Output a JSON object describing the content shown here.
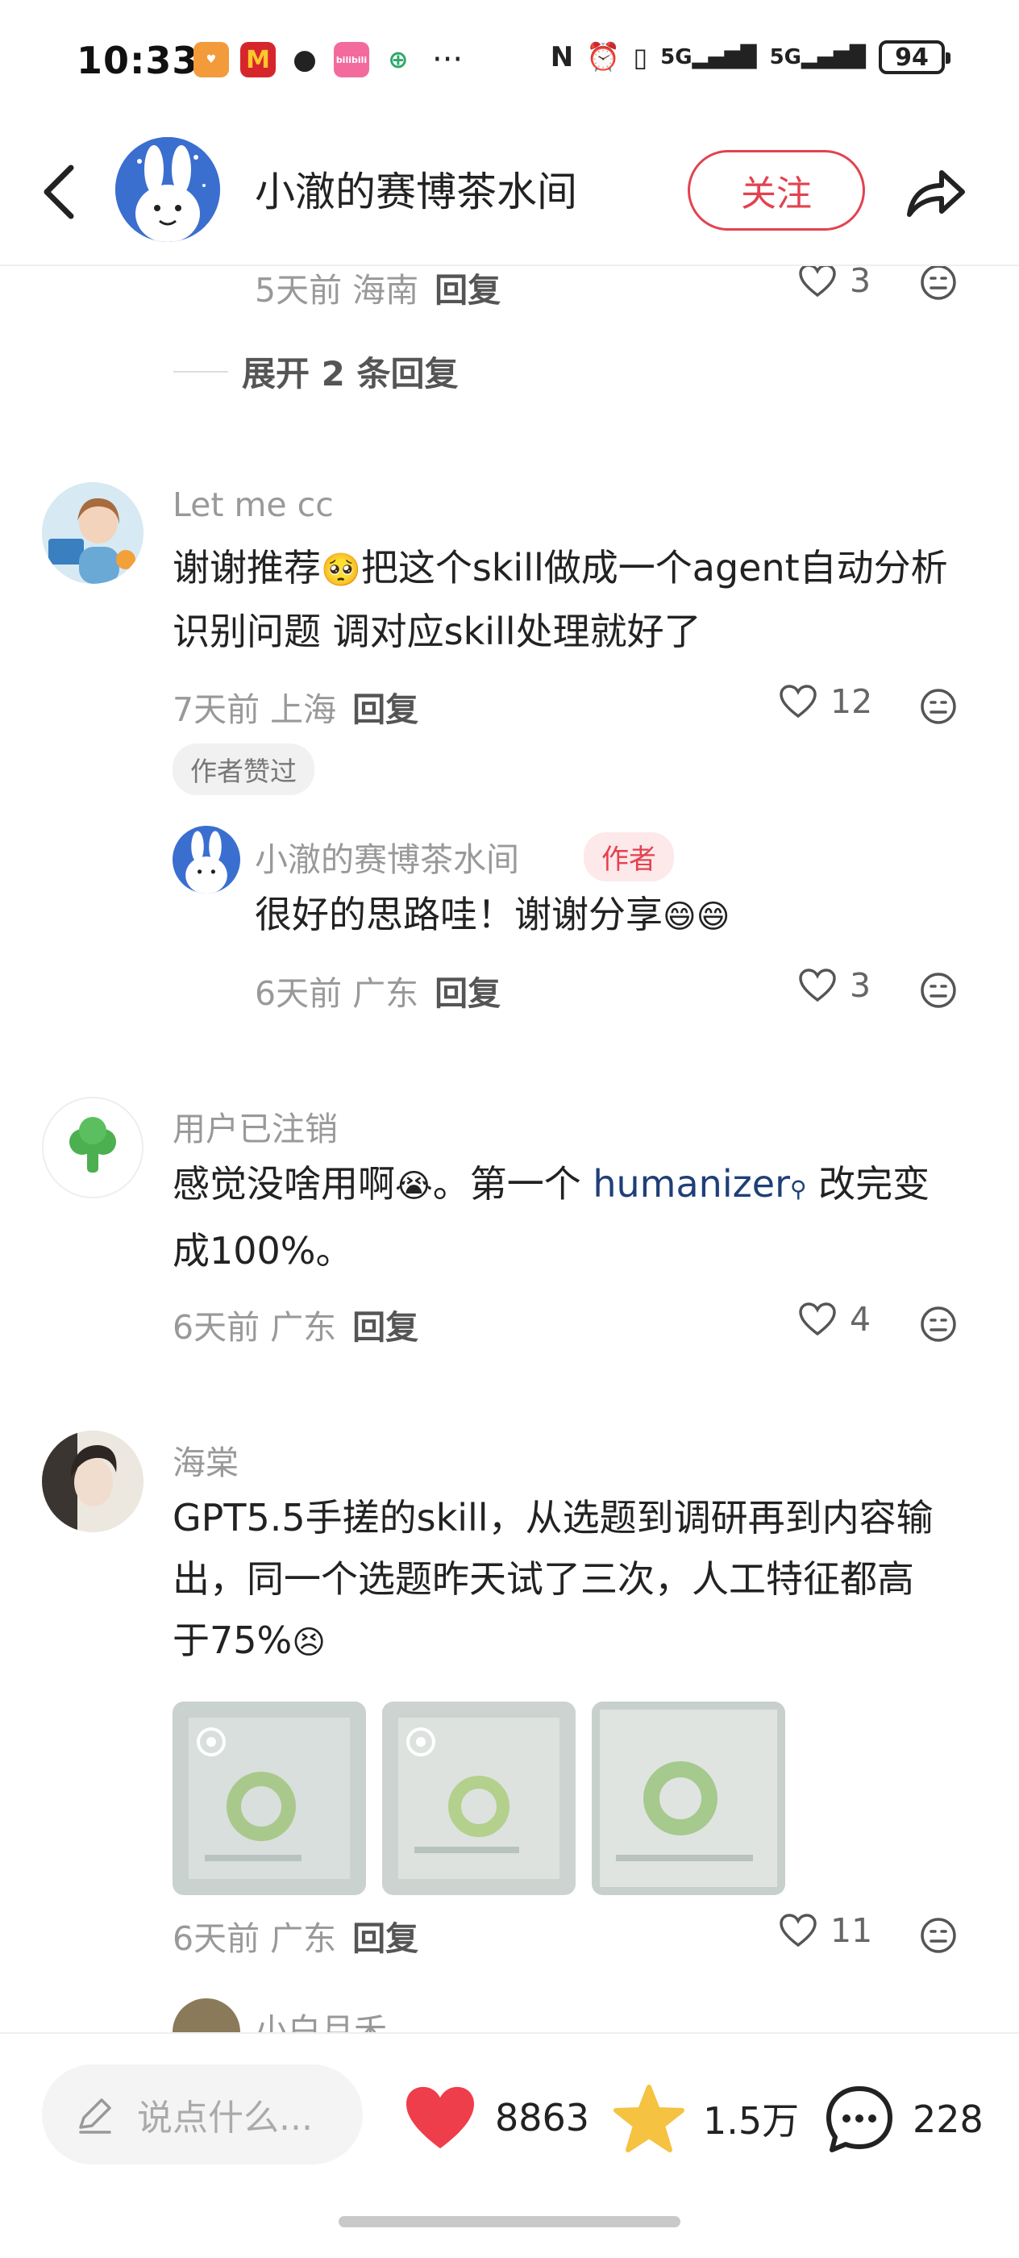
{
  "status_bar": {
    "time": "10:33",
    "apps": [
      "bilibili"
    ],
    "more": "···",
    "signal_1": "5G",
    "signal_2": "5G",
    "battery": "94"
  },
  "header": {
    "title": "小澈的赛博茶水间",
    "follow_label": "关注"
  },
  "comments": {
    "prev_meta": {
      "time": "5天前",
      "location": "海南",
      "reply": "回复",
      "likes": "3"
    },
    "expand_label": "展开 2 条回复",
    "c1": {
      "name": "Let me cc",
      "text_line1": "谢谢推荐",
      "text_line1b": "把这个skill做成一个agent自动分析",
      "text_line2": "识别问题 调对应skill处理就好了",
      "time": "7天前",
      "location": "上海",
      "reply": "回复",
      "likes": "12",
      "author_liked": "作者赞过"
    },
    "c1_reply": {
      "name": "小澈的赛博茶水间",
      "author_badge": "作者",
      "text": "很好的思路哇！谢谢分享",
      "time": "6天前",
      "location": "广东",
      "reply": "回复",
      "likes": "3"
    },
    "c2": {
      "name": "用户已注销",
      "text_a": "感觉没啥用啊",
      "text_b": "。第一个 ",
      "link": "humanizer",
      "text_c": " 改完变",
      "text_line2": "成100%。",
      "time": "6天前",
      "location": "广东",
      "reply": "回复",
      "likes": "4"
    },
    "c3": {
      "name": "海棠",
      "text_line1": "GPT5.5手搓的skill，从选题到调研再到内容输",
      "text_line2": "出，同一个选题昨天试了三次，人工特征都高",
      "text_line3": "于75%",
      "time": "6天前",
      "location": "广东",
      "reply": "回复",
      "likes": "11"
    },
    "c4": {
      "name": "小白月禾"
    }
  },
  "bottom_bar": {
    "input_placeholder": "说点什么...",
    "likes": "8863",
    "favorites": "1.5万",
    "comments": "228"
  },
  "colors": {
    "accent": "#e3424f",
    "link": "#1f3f78",
    "star": "#f5c242"
  }
}
